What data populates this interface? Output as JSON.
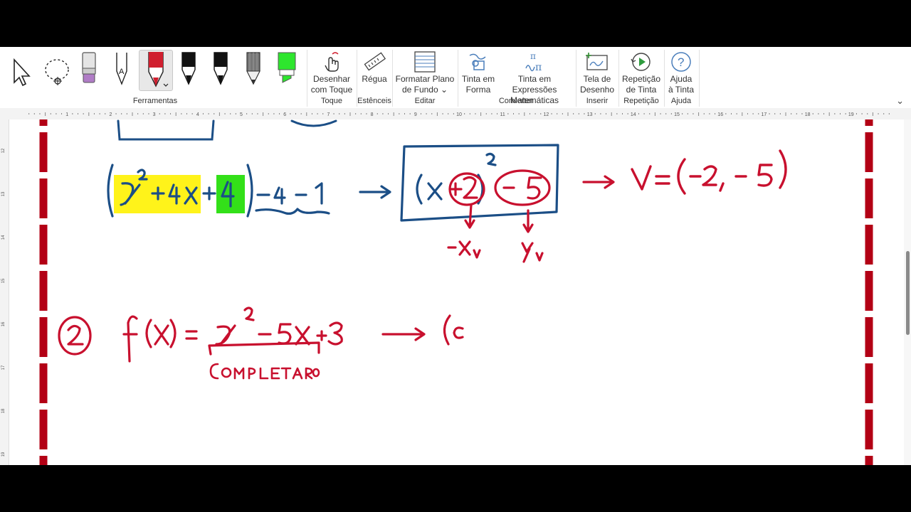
{
  "ribbon": {
    "groups": {
      "ferramentas": "Ferramentas",
      "toque": "Toque",
      "estenceis": "Estênceis",
      "editar": "Editar",
      "converter": "Converter",
      "inserir": "Inserir",
      "repeticao": "Repetição",
      "ajuda": "Ajuda"
    },
    "buttons": {
      "desenhar_toque": [
        "Desenhar",
        "com Toque"
      ],
      "regua": "Régua",
      "formatar_plano": [
        "Formatar Plano",
        "de Fundo ⌄"
      ],
      "tinta_forma": [
        "Tinta em",
        "Forma"
      ],
      "tinta_expressoes": [
        "Tinta em Expressões",
        "Matemáticas"
      ],
      "tela_desenho": [
        "Tela de",
        "Desenho"
      ],
      "repeticao_tinta": [
        "Repetição",
        "de Tinta"
      ],
      "ajuda_tinta": [
        "Ajuda",
        "à Tinta"
      ]
    },
    "pen_colors": {
      "eraser": "#b07cc6",
      "pencil": "#222222",
      "red_pen": "#d01f2f",
      "black_pen_1": "#111111",
      "black_pen_2": "#111111",
      "gray_pencil": "#555555",
      "highlighter": "#2ee62e"
    }
  },
  "ruler_numbers": [
    "1",
    "2",
    "3",
    "4",
    "5",
    "6",
    "7",
    "8",
    "9",
    "10",
    "11",
    "12",
    "13",
    "14",
    "15",
    "16",
    "17",
    "18",
    "19"
  ],
  "vruler_numbers": [
    "12",
    "13",
    "14",
    "15",
    "16",
    "17",
    "18",
    "19"
  ],
  "ink": {
    "colors": {
      "blue": "#1b4e86",
      "red": "#c8102e",
      "yellow": "#fff31a",
      "green": "#33e019",
      "margin": "#b30015"
    },
    "eq1_terms": [
      "x",
      "2",
      "+",
      "4",
      "x",
      "+",
      "4",
      "-",
      "4",
      "-",
      "1"
    ],
    "eq1_box": [
      "(",
      "x",
      "+2",
      ")",
      "2",
      "-5"
    ],
    "vertex": [
      "V",
      "=",
      "(",
      "-2",
      ",",
      "-",
      "5",
      ")"
    ],
    "vertex_labels": [
      "-x",
      "v",
      "y",
      "v"
    ],
    "item_number": "2",
    "eq2": [
      "f(x)",
      "=",
      "x",
      "2",
      "-",
      "5",
      "x",
      "+3"
    ],
    "eq2_partial": "(c",
    "completar": "COMPLETAR O"
  }
}
